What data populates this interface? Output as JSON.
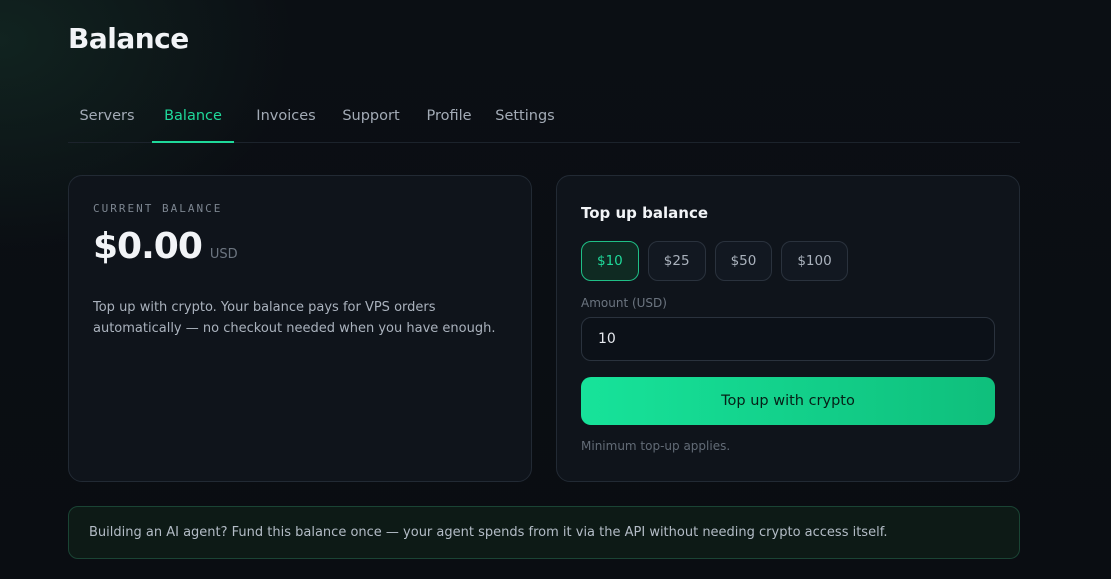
{
  "page": {
    "title": "Balance"
  },
  "tabs": [
    {
      "label": "Servers",
      "active": false
    },
    {
      "label": "Balance",
      "active": true
    },
    {
      "label": "Invoices",
      "active": false
    },
    {
      "label": "Support",
      "active": false
    },
    {
      "label": "Profile",
      "active": false
    },
    {
      "label": "Settings",
      "active": false
    }
  ],
  "balance_card": {
    "label": "CURRENT BALANCE",
    "amount": "$0.00",
    "currency": "USD",
    "description": "Top up with crypto. Your balance pays for VPS orders automatically — no checkout needed when you have enough."
  },
  "topup_card": {
    "title": "Top up balance",
    "presets": [
      {
        "label": "$10",
        "selected": true
      },
      {
        "label": "$25",
        "selected": false
      },
      {
        "label": "$50",
        "selected": false
      },
      {
        "label": "$100",
        "selected": false
      }
    ],
    "amount_label": "Amount (USD)",
    "amount_value": "10",
    "button_label": "Top up with crypto",
    "note": "Minimum top-up applies."
  },
  "banner": {
    "text": "Building an AI agent? Fund this balance once — your agent spends from it via the API without needing crypto access itself."
  },
  "colors": {
    "accent": "#1fd99a",
    "background": "#0a0d12",
    "card": "#0f141b"
  }
}
